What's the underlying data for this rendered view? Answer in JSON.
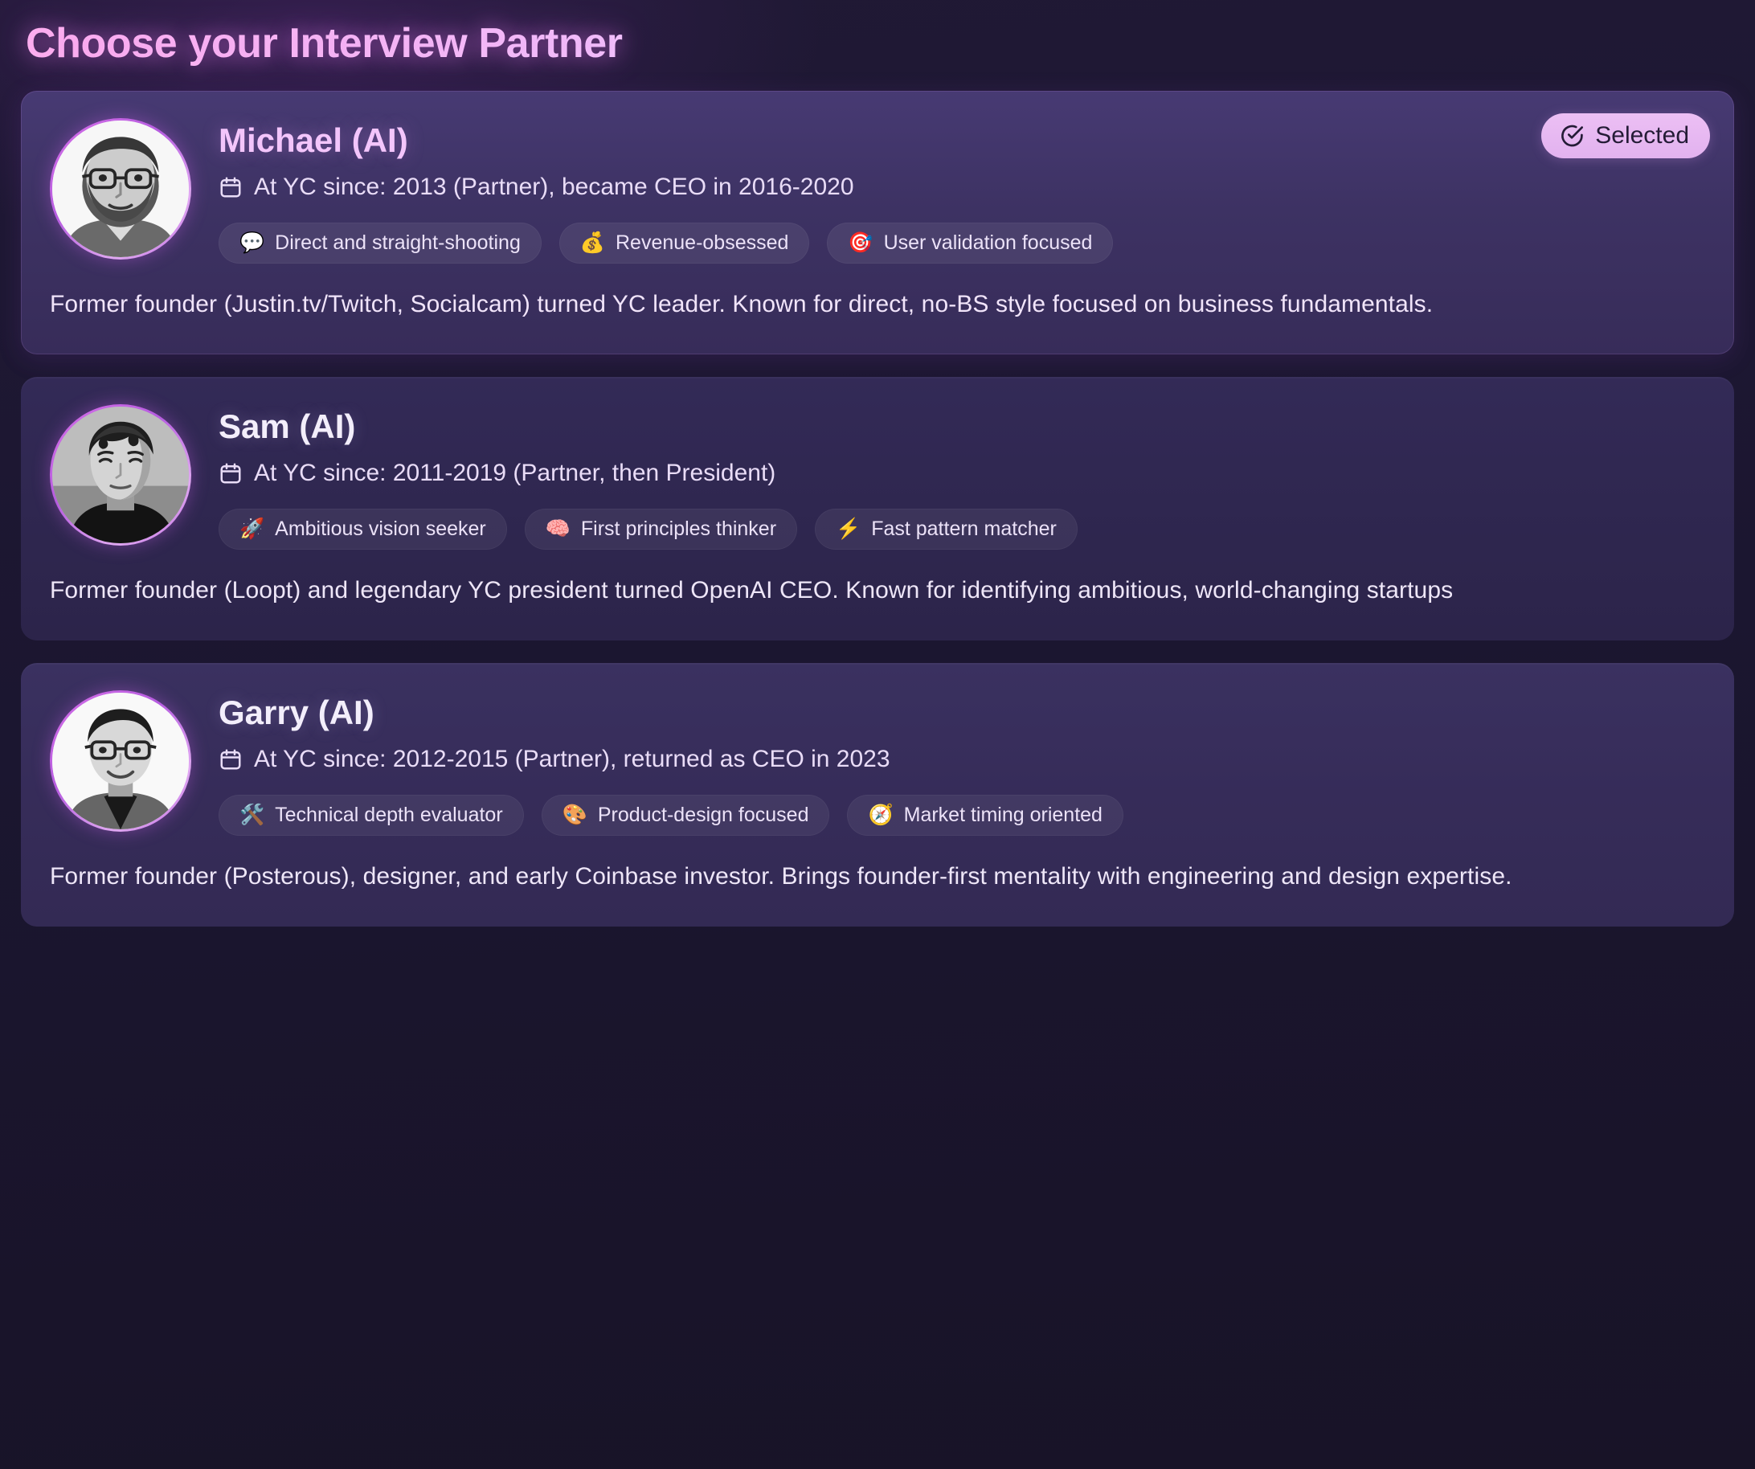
{
  "page": {
    "title": "Choose your Interview Partner",
    "background_color": "#191429",
    "accent_color": "#f3c5fb"
  },
  "badge": {
    "label": "Selected",
    "icon": "check-circle-icon",
    "background_color": "#e9bcf2",
    "text_color": "#241b36"
  },
  "partners": [
    {
      "name": "Michael (AI)",
      "meta_icon": "calendar-icon",
      "meta": "At YC since: 2013 (Partner), became CEO in 2016-2020",
      "selected": true,
      "avatar": "michael-avatar",
      "tags": [
        {
          "icon": "speech-balloon-icon",
          "emoji": "💬",
          "label": "Direct and straight-shooting"
        },
        {
          "icon": "money-bag-icon",
          "emoji": "💰",
          "label": "Revenue-obsessed"
        },
        {
          "icon": "dart-icon",
          "emoji": "🎯",
          "label": "User validation focused"
        }
      ],
      "description": "Former founder (Justin.tv/Twitch, Socialcam) turned YC leader. Known for direct, no-BS style focused on business fundamentals."
    },
    {
      "name": "Sam (AI)",
      "meta_icon": "calendar-icon",
      "meta": "At YC since: 2011-2019 (Partner, then President)",
      "selected": false,
      "avatar": "sam-avatar",
      "tags": [
        {
          "icon": "rocket-icon",
          "emoji": "🚀",
          "label": "Ambitious vision seeker"
        },
        {
          "icon": "brain-icon",
          "emoji": "🧠",
          "label": "First principles thinker"
        },
        {
          "icon": "lightning-icon",
          "emoji": "⚡",
          "label": "Fast pattern matcher"
        }
      ],
      "description": "Former founder (Loopt) and legendary YC president turned OpenAI CEO. Known for identifying ambitious, world-changing startups"
    },
    {
      "name": "Garry (AI)",
      "meta_icon": "calendar-icon",
      "meta": "At YC since: 2012-2015 (Partner), returned as CEO in 2023",
      "selected": false,
      "avatar": "garry-avatar",
      "tags": [
        {
          "icon": "tools-icon",
          "emoji": "🛠️",
          "label": "Technical depth evaluator"
        },
        {
          "icon": "artist-palette-icon",
          "emoji": "🎨",
          "label": "Product-design focused"
        },
        {
          "icon": "compass-icon",
          "emoji": "🧭",
          "label": "Market timing oriented"
        }
      ],
      "description": "Former founder (Posterous), designer, and early Coinbase investor. Brings founder-first mentality with engineering and design expertise."
    }
  ]
}
